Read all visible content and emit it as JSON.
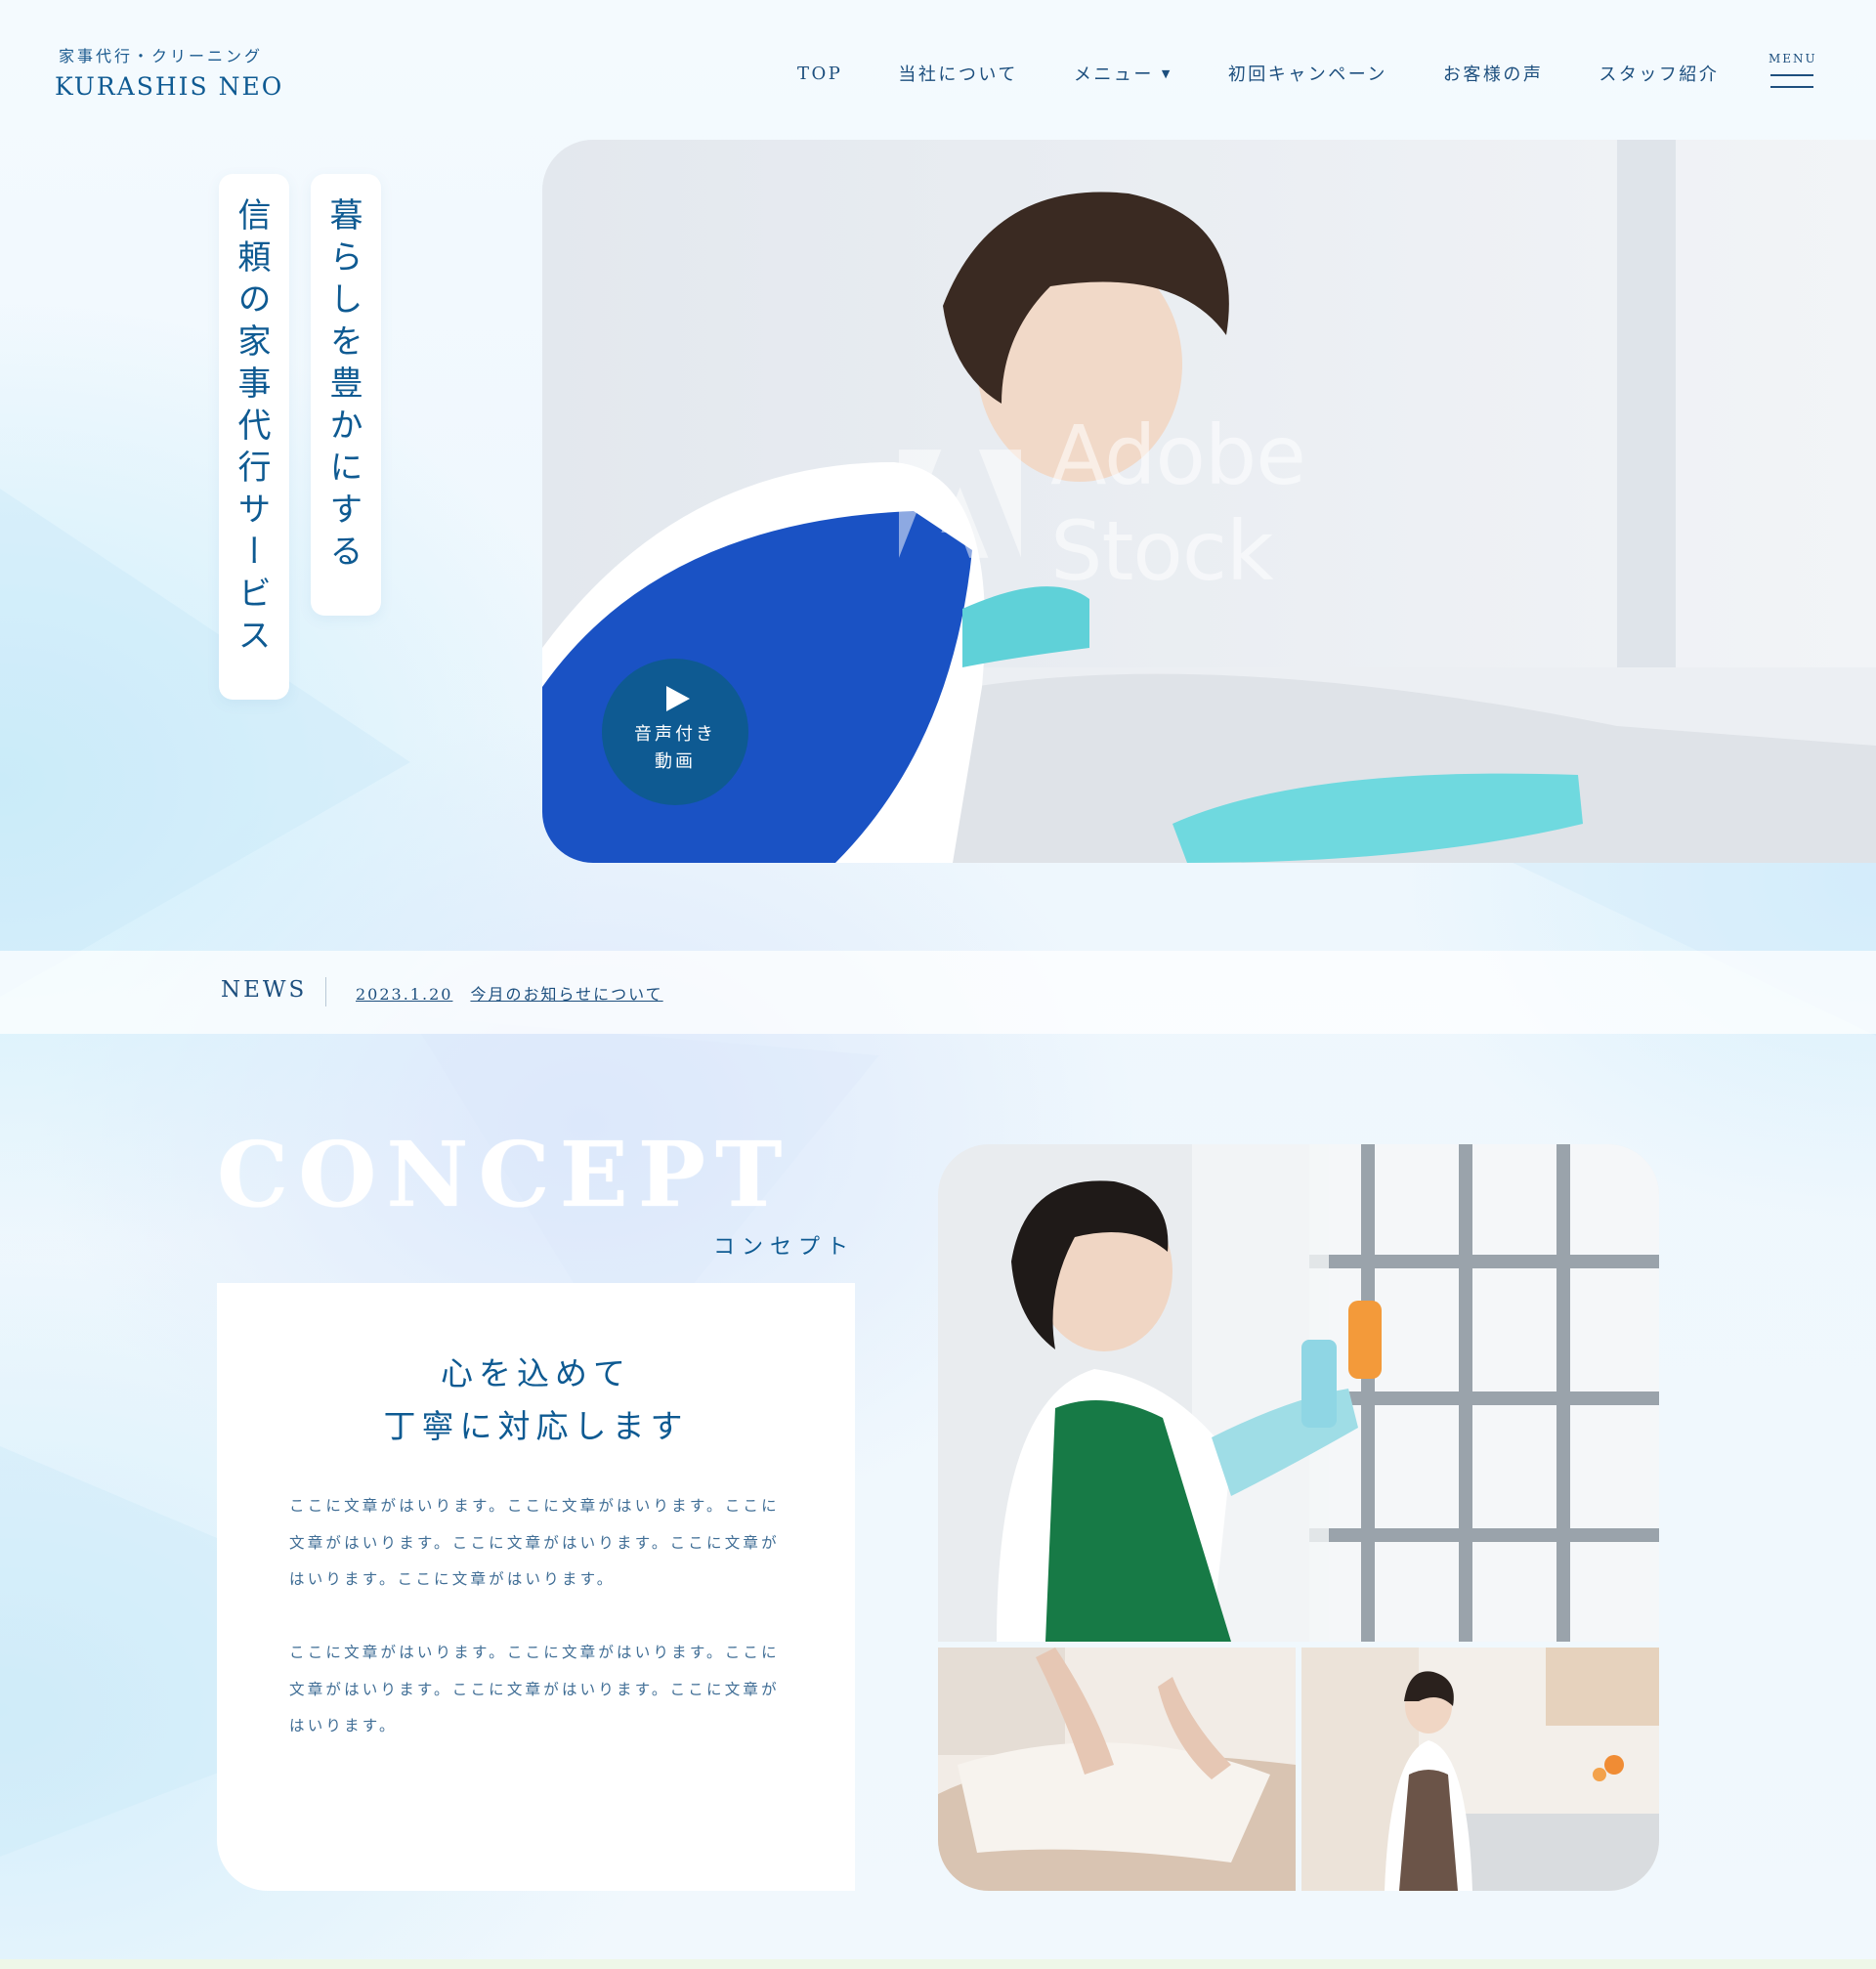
{
  "header": {
    "logo_sub": "家事代行・クリーニング",
    "logo_main": "KURASHIS NEO",
    "nav": [
      {
        "label": "TOP"
      },
      {
        "label": "当社について"
      },
      {
        "label": "メニュー",
        "caret": "▼"
      },
      {
        "label": "初回キャンペーン"
      },
      {
        "label": "お客様の声"
      },
      {
        "label": "スタッフ紹介"
      }
    ],
    "menu_label": "MENU"
  },
  "hero": {
    "catch_1": "暮らしを豊かにする",
    "catch_2": "信頼の家事代行サービス",
    "watermark": "Adobe Stock",
    "video_label_1": "音声付き",
    "video_label_2": "動画"
  },
  "news": {
    "label": "NEWS",
    "date": "2023.1.20",
    "title": "今月のお知らせについて"
  },
  "concept": {
    "title": "CONCEPT",
    "subtitle": "コンセプト",
    "heading_1": "心を込めて",
    "heading_2": "丁寧に対応します",
    "paragraph_1": "ここに文章がはいります。ここに文章がはいります。ここに文章がはいります。ここに文章がはいります。ここに文章がはいります。ここに文章がはいります。",
    "paragraph_2": "ここに文章がはいります。ここに文章がはいります。ここに文章がはいります。ここに文章がはいります。ここに文章がはいります。"
  },
  "colors": {
    "primary": "#0e5a92",
    "text_muted": "#3f6d95",
    "background": "#eef7fd"
  }
}
